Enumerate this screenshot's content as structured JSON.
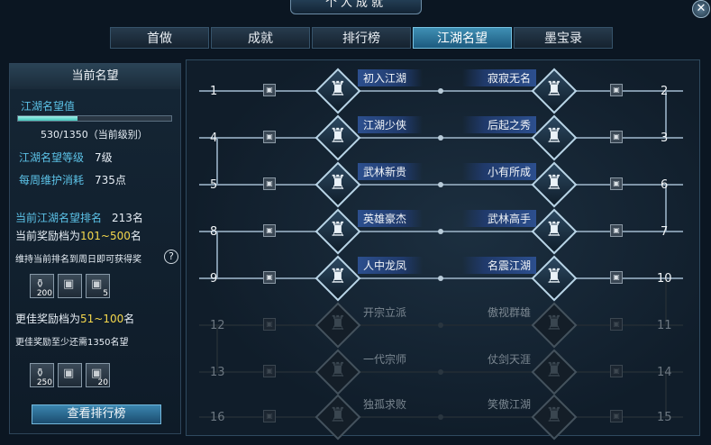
{
  "window": {
    "title": "个人成就",
    "close": "✕"
  },
  "tabs": [
    {
      "label": "首做",
      "active": false
    },
    {
      "label": "成就",
      "active": false
    },
    {
      "label": "排行榜",
      "active": false
    },
    {
      "label": "江湖名望",
      "active": true
    },
    {
      "label": "墨宝录",
      "active": false
    }
  ],
  "left": {
    "header": "当前名望",
    "fame_label": "江湖名望值",
    "fame_progress": 0.39,
    "fame_value": "530/1350（当前级别）",
    "level_label": "江湖名望等级",
    "level_value": "7级",
    "upkeep_label": "每周维护消耗",
    "upkeep_value": "735点",
    "rank_label": "当前江湖名望排名",
    "rank_value": "213名",
    "reward_tier_label": "当前奖励档为",
    "reward_tier_value": "101~500",
    "reward_tier_suffix": "名",
    "keep_rank_text": "维持当前排名到周日即可获得奖",
    "help": "?",
    "items1": [
      {
        "icon": "silver-bag-icon",
        "glyph": "⚱",
        "count": "200"
      },
      {
        "icon": "chest-icon",
        "glyph": "▣",
        "count": ""
      },
      {
        "icon": "chest-icon",
        "glyph": "▣",
        "count": "5"
      }
    ],
    "better_tier_label": "更佳奖励档为",
    "better_tier_value": "51~100",
    "better_tier_suffix": "名",
    "better_need_text": "更佳奖励至少还需1350名望",
    "items2": [
      {
        "icon": "silver-bag-icon",
        "glyph": "⚱",
        "count": "250"
      },
      {
        "icon": "chest-icon",
        "glyph": "▣",
        "count": ""
      },
      {
        "icon": "chest-icon",
        "glyph": "▣",
        "count": "20"
      }
    ],
    "rank_button": "查看排行榜"
  },
  "ranks": [
    {
      "n": "1",
      "title": "初入江湖",
      "side": "left",
      "locked": false
    },
    {
      "n": "2",
      "title": "寂寂无名",
      "side": "right",
      "locked": false
    },
    {
      "n": "3",
      "title": "后起之秀",
      "side": "right",
      "locked": false
    },
    {
      "n": "4",
      "title": "江湖少侠",
      "side": "left",
      "locked": false
    },
    {
      "n": "5",
      "title": "武林新贵",
      "side": "left",
      "locked": false
    },
    {
      "n": "6",
      "title": "小有所成",
      "side": "right",
      "locked": false
    },
    {
      "n": "7",
      "title": "武林高手",
      "side": "right",
      "locked": false
    },
    {
      "n": "8",
      "title": "英雄豪杰",
      "side": "left",
      "locked": false
    },
    {
      "n": "9",
      "title": "人中龙凤",
      "side": "left",
      "locked": false
    },
    {
      "n": "10",
      "title": "名震江湖",
      "side": "right",
      "locked": false
    },
    {
      "n": "11",
      "title": "傲视群雄",
      "side": "right",
      "locked": true
    },
    {
      "n": "12",
      "title": "开宗立派",
      "side": "left",
      "locked": true
    },
    {
      "n": "13",
      "title": "一代宗师",
      "side": "left",
      "locked": true
    },
    {
      "n": "14",
      "title": "仗剑天涯",
      "side": "right",
      "locked": true
    },
    {
      "n": "15",
      "title": "笑傲江湖",
      "side": "right",
      "locked": true
    },
    {
      "n": "16",
      "title": "独孤求败",
      "side": "left",
      "locked": true
    }
  ],
  "chest_glyph": "▣",
  "figure_glyph": "♜"
}
